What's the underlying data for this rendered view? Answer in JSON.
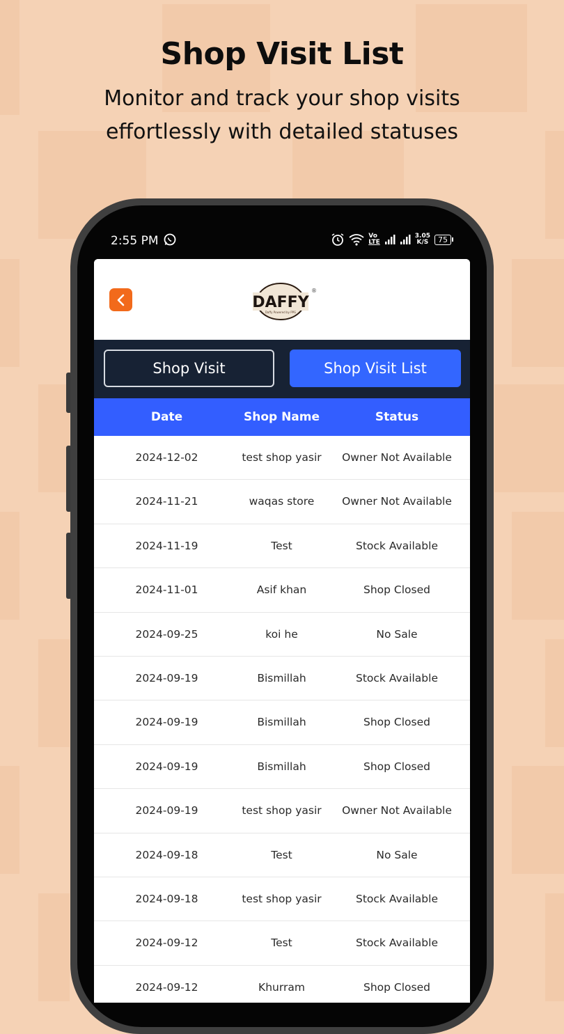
{
  "promo": {
    "title": "Shop Visit List",
    "subtitle": "Monitor and track your shop visits effortlessly with detailed statuses"
  },
  "status_bar": {
    "time": "2:55 PM",
    "network_speed_value": "3.05",
    "network_speed_unit": "K/S",
    "battery": "75",
    "volte_top": "Vo",
    "volte_bottom": "LTE",
    "icons": [
      "whatsapp-icon",
      "alarm-icon",
      "wifi-icon",
      "signal-icon",
      "signal-icon",
      "battery-icon"
    ]
  },
  "header": {
    "back_icon": "chevron-left-icon",
    "logo_text": "DAFFY",
    "logo_subtext": "Daffy Powered by PPG",
    "logo_mark": "®"
  },
  "tabs": [
    {
      "label": "Shop Visit",
      "active": false
    },
    {
      "label": "Shop Visit List",
      "active": true
    }
  ],
  "table": {
    "columns": [
      "Date",
      "Shop Name",
      "Status"
    ],
    "rows": [
      {
        "date": "2024-12-02",
        "shop": "test shop yasir",
        "status": "Owner Not Available"
      },
      {
        "date": "2024-11-21",
        "shop": "waqas store",
        "status": "Owner Not Available"
      },
      {
        "date": "2024-11-19",
        "shop": "Test",
        "status": "Stock Available"
      },
      {
        "date": "2024-11-01",
        "shop": "Asif khan",
        "status": "Shop Closed"
      },
      {
        "date": "2024-09-25",
        "shop": "koi he",
        "status": "No Sale"
      },
      {
        "date": "2024-09-19",
        "shop": "Bismillah",
        "status": "Stock Available"
      },
      {
        "date": "2024-09-19",
        "shop": "Bismillah",
        "status": "Shop Closed"
      },
      {
        "date": "2024-09-19",
        "shop": "Bismillah",
        "status": "Shop Closed"
      },
      {
        "date": "2024-09-19",
        "shop": "test shop yasir",
        "status": "Owner Not Available"
      },
      {
        "date": "2024-09-18",
        "shop": "Test",
        "status": "No Sale"
      },
      {
        "date": "2024-09-18",
        "shop": "test shop yasir",
        "status": "Stock Available"
      },
      {
        "date": "2024-09-12",
        "shop": "Test",
        "status": "Stock Available"
      },
      {
        "date": "2024-09-12",
        "shop": "Khurram",
        "status": "Shop Closed"
      }
    ]
  },
  "colors": {
    "background": "#f5d2b5",
    "tab_bar": "#172234",
    "accent_blue": "#3366ff",
    "table_header": "#335eff",
    "back_button": "#f26a1b"
  }
}
